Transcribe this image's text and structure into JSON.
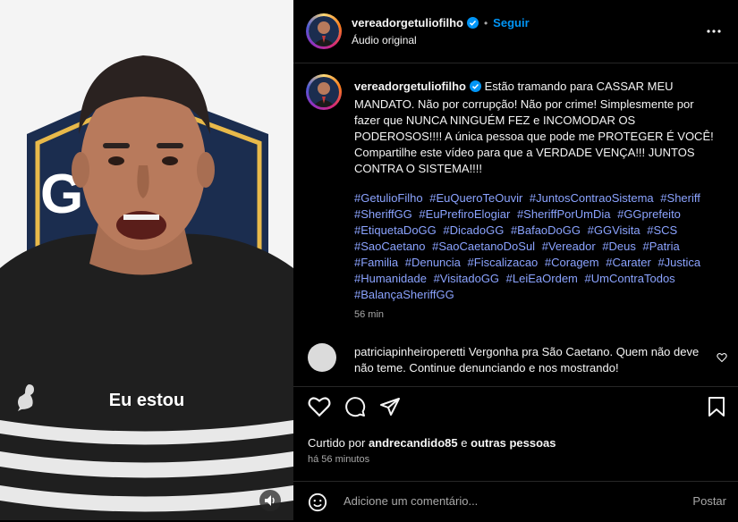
{
  "video": {
    "subtitle": "Eu estou",
    "logo_text": "G      IO"
  },
  "header": {
    "username": "vereadorgetuliofilho",
    "follow_label": "Seguir",
    "audio_label": "Áudio original"
  },
  "caption": {
    "username": "vereadorgetuliofilho",
    "text": "Estão tramando para CASSAR MEU MANDATO. Não por corrupção! Não por crime! Simplesmente por fazer que NUNCA NINGUÉM FEZ e INCOMODAR OS PODEROSOS!!!! A única pessoa que pode me PROTEGER É VOCÊ! Compartilhe este vídeo para que a VERDADE VENÇA!!! JUNTOS CONTRA O SISTEMA!!!!",
    "hashtags": [
      "#GetulioFilho",
      "#EuQueroTeOuvir",
      "#JuntosContraoSistema",
      "#Sheriff",
      "#SheriffGG",
      "#EuPrefiroElogiar",
      "#SheriffPorUmDia",
      "#GGprefeito",
      "#EtiquetaDoGG",
      "#DicadoGG",
      "#BafaoDoGG",
      "#GGVisita",
      "#SCS",
      "#SaoCaetano",
      "#SaoCaetanoDoSul",
      "#Vereador",
      "#Deus",
      "#Patria",
      "#Familia",
      "#Denuncia",
      "#Fiscalizacao",
      "#Coragem",
      "#Carater",
      "#Justica",
      "#Humanidade",
      "#VisitadoGG",
      "#LeiEaOrdem",
      "#UmContraTodos",
      "#BalançaSheriffGG"
    ],
    "time": "56 min"
  },
  "comment": {
    "username": "patriciapinheiroperetti",
    "text": "Vergonha pra São Caetano. Quem não deve não teme. Continue denunciando e nos mostrando!"
  },
  "footer": {
    "liked_prefix": "Curtido por",
    "liked_user": "andrecandido85",
    "liked_and": "e",
    "liked_others": "outras pessoas",
    "ago": "há 56 minutos",
    "add_comment_placeholder": "Adicione um comentário...",
    "post_label": "Postar"
  },
  "colors": {
    "link": "#0095f6",
    "hashtag": "#8ba3ff",
    "background": "#000000"
  }
}
